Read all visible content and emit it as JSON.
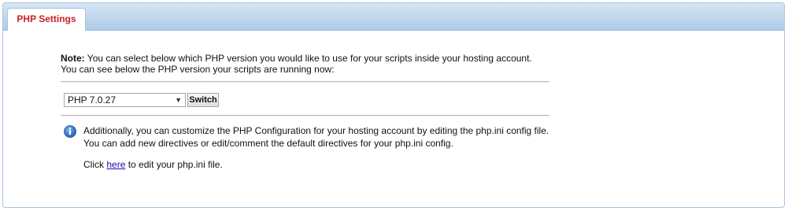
{
  "tab": {
    "label": "PHP Settings"
  },
  "note": {
    "prefix": "Note:",
    "line1": " You can select below which PHP version you would like to use for your scripts inside your hosting account.",
    "line2": "You can see below the PHP version your scripts are running now:"
  },
  "version_select": {
    "selected": "PHP 7.0.27",
    "arrow": "▼"
  },
  "switch_button": {
    "label": "Switch"
  },
  "info": {
    "line1": "Additionally, you can customize the PHP Configuration for your hosting account by editing the php.ini config file.",
    "line2": "You can add new directives or edit/comment the default directives for your php.ini config.",
    "click_prefix": "Click ",
    "link_text": "here",
    "click_suffix": " to edit your php.ini file.",
    "icon": "info-icon"
  },
  "colors": {
    "tab_text": "#c8202a",
    "header_bar": "#aecbe7",
    "link": "#1a0dab",
    "info_icon": "#2b73c9"
  }
}
